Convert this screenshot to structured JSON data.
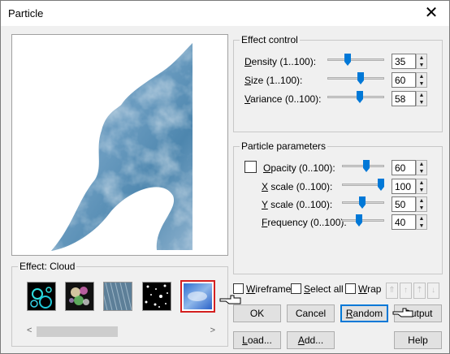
{
  "window": {
    "title": "Particle",
    "close_glyph": "✕"
  },
  "effect_control": {
    "title": "Effect control",
    "rows": [
      {
        "key": "D",
        "label": "ensity (1..100):",
        "value": "35"
      },
      {
        "key": "S",
        "label": "ize (1..100):",
        "value": "60"
      },
      {
        "key": "V",
        "label": "ariance (0..100):",
        "value": "58"
      }
    ]
  },
  "particle_parameters": {
    "title": "Particle parameters",
    "rows": [
      {
        "key": "O",
        "label": "pacity (0..100):",
        "value": "60"
      },
      {
        "key": "X",
        "label": " scale (0..100):",
        "value": "100"
      },
      {
        "key": "Y",
        "label": " scale (0..100):",
        "value": "50"
      },
      {
        "key": "F",
        "label": "requency (0..100):",
        "value": "40"
      }
    ]
  },
  "effect": {
    "label": "Effect: Cloud"
  },
  "options": {
    "wireframe": {
      "key": "W",
      "label": "ireframe"
    },
    "select_all": {
      "key": "S",
      "label": "elect all"
    },
    "wrap": {
      "key": "W",
      "label": "rap"
    }
  },
  "buttons": {
    "ok": "OK",
    "cancel": "Cancel",
    "random": {
      "key": "R",
      "label": "andom"
    },
    "output": "Output",
    "load": {
      "key": "L",
      "label": "oad..."
    },
    "add": {
      "key": "A",
      "label": "dd..."
    },
    "help": "Help"
  },
  "colors": {
    "accent": "#0078d7",
    "highlight": "#d42020",
    "sky": "#4f86ad"
  },
  "icons": [
    "close-icon",
    "spin-up-icon",
    "spin-down-icon",
    "move-top-icon",
    "move-up-icon",
    "move-down-icon",
    "move-bottom-icon",
    "pointing-hand-cursor"
  ]
}
